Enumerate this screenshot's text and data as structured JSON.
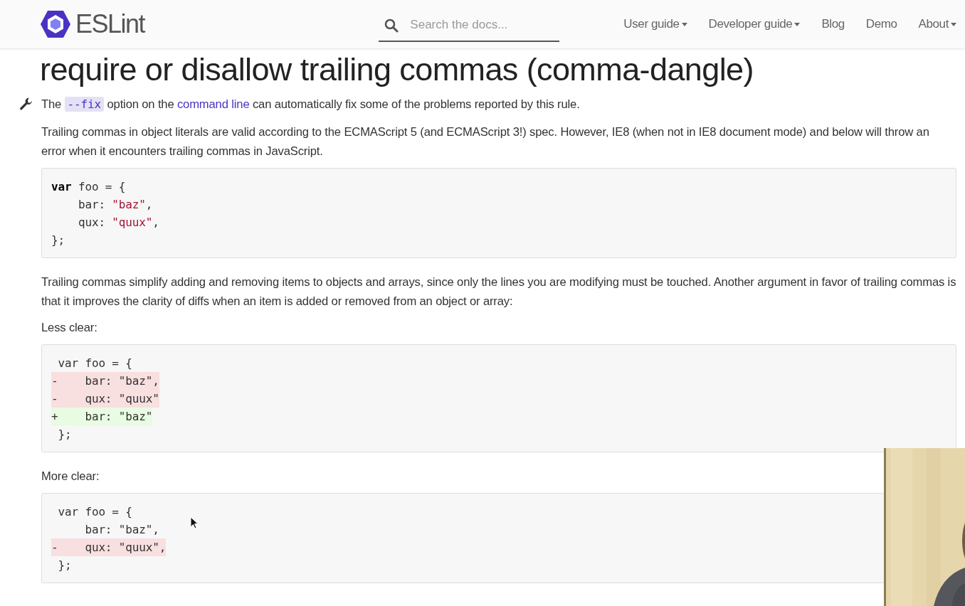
{
  "header": {
    "brand": "ESLint",
    "search": {
      "placeholder": "Search the docs..."
    },
    "nav": [
      {
        "label": "User guide",
        "dropdown": true
      },
      {
        "label": "Developer guide",
        "dropdown": true
      },
      {
        "label": "Blog",
        "dropdown": false
      },
      {
        "label": "Demo",
        "dropdown": false
      },
      {
        "label": "About",
        "dropdown": true
      }
    ]
  },
  "title": "require or disallow trailing commas (comma-dangle)",
  "fix_note": [
    {
      "kind": "text",
      "text": "The "
    },
    {
      "kind": "code",
      "text": "--fix"
    },
    {
      "kind": "text",
      "text": " option on the "
    },
    {
      "kind": "link",
      "text": "command line"
    },
    {
      "kind": "text",
      "text": " can automatically fix some of the problems reported by this rule."
    }
  ],
  "blocks": [
    {
      "kind": "paragraph",
      "text": "Trailing commas in object literals are valid according to the ECMAScript 5 (and ECMAScript 3!) spec. However, IE8 (when not in IE8 document mode) and below will throw an error when it encounters trailing commas in JavaScript."
    },
    {
      "kind": "code",
      "lines": [
        {
          "kind": "plain",
          "tokens": [
            {
              "kind": "keyword",
              "text": "var"
            },
            {
              "kind": "text",
              "text": " foo = {"
            }
          ]
        },
        {
          "kind": "plain",
          "tokens": [
            {
              "kind": "text",
              "text": "    bar: "
            },
            {
              "kind": "string",
              "text": "\"baz\""
            },
            {
              "kind": "text",
              "text": ","
            }
          ]
        },
        {
          "kind": "plain",
          "tokens": [
            {
              "kind": "text",
              "text": "    qux: "
            },
            {
              "kind": "string",
              "text": "\"quux\""
            },
            {
              "kind": "text",
              "text": ","
            }
          ]
        },
        {
          "kind": "plain",
          "tokens": [
            {
              "kind": "text",
              "text": "};"
            }
          ]
        }
      ]
    },
    {
      "kind": "paragraph",
      "text": "Trailing commas simplify adding and removing items to objects and arrays, since only the lines you are modifying must be touched. Another argument in favor of trailing commas is that it improves the clarity of diffs when an item is added or removed from an object or array:"
    },
    {
      "kind": "paragraph",
      "text": "Less clear:"
    },
    {
      "kind": "code",
      "lines": [
        {
          "kind": "plain",
          "tokens": [
            {
              "kind": "text",
              "text": " var foo = {"
            }
          ]
        },
        {
          "kind": "removed",
          "tokens": [
            {
              "kind": "text",
              "text": "-    bar: \"baz\","
            }
          ]
        },
        {
          "kind": "removed",
          "tokens": [
            {
              "kind": "text",
              "text": "-    qux: \"quux\""
            }
          ]
        },
        {
          "kind": "added",
          "tokens": [
            {
              "kind": "text",
              "text": "+    bar: \"baz\""
            }
          ]
        },
        {
          "kind": "plain",
          "tokens": [
            {
              "kind": "text",
              "text": " };"
            }
          ]
        }
      ]
    },
    {
      "kind": "paragraph",
      "text": "More clear:"
    },
    {
      "kind": "code",
      "lines": [
        {
          "kind": "plain",
          "tokens": [
            {
              "kind": "text",
              "text": " var foo = {"
            }
          ]
        },
        {
          "kind": "plain",
          "tokens": [
            {
              "kind": "text",
              "text": "     bar: \"baz\","
            }
          ]
        },
        {
          "kind": "removed",
          "tokens": [
            {
              "kind": "text",
              "text": "-    qux: \"quux\","
            }
          ]
        },
        {
          "kind": "plain",
          "tokens": [
            {
              "kind": "text",
              "text": " };"
            }
          ]
        }
      ]
    }
  ]
}
